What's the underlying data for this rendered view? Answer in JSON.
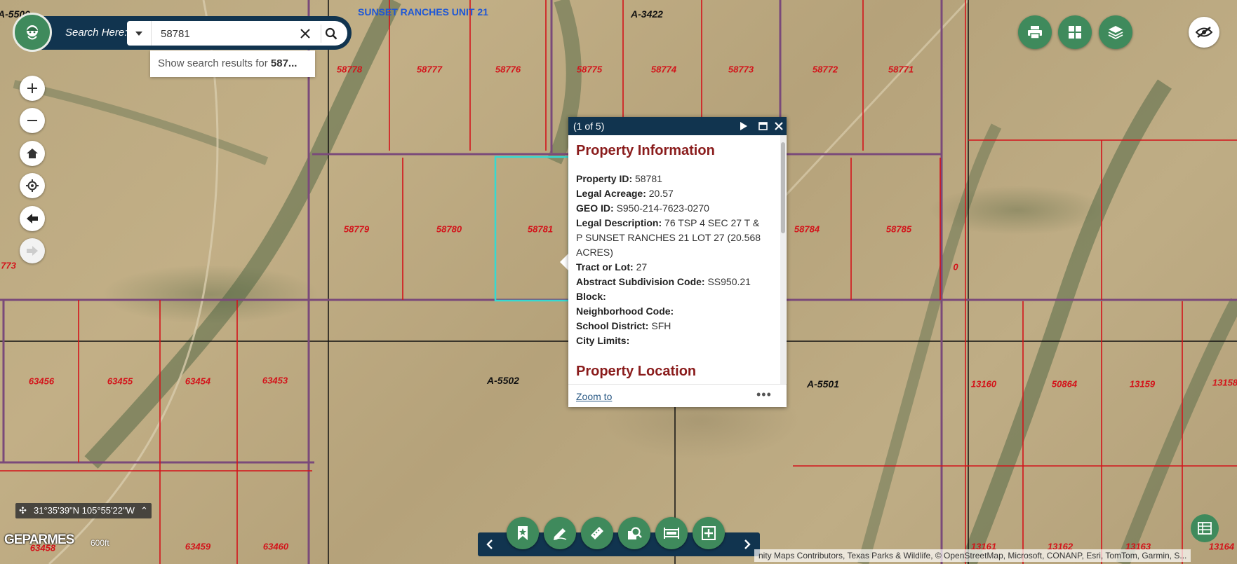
{
  "search": {
    "label": "Search Here:",
    "value": "58781",
    "suggestion_prefix": "Show search results for ",
    "suggestion_term": "587..."
  },
  "map": {
    "subdivision_label": "SUNSET RANCHES UNIT 21",
    "abstract_labels": [
      "A-5500",
      "A-3422",
      "A-5502",
      "A-5501"
    ],
    "parcel_labels": [
      "58778",
      "58777",
      "58776",
      "58775",
      "58774",
      "58773",
      "58772",
      "58771",
      "58779",
      "58780",
      "58781",
      "58784",
      "58785",
      "63456",
      "63455",
      "63454",
      "63453",
      "13160",
      "50864",
      "13159",
      "13158",
      "63458",
      "63459",
      "63460",
      "13161",
      "13162",
      "13163",
      "13164",
      "773",
      "0"
    ]
  },
  "popup": {
    "count": "(1 of 5)",
    "section_info": "Property Information",
    "fields": [
      {
        "label": "Property ID:",
        "value": "58781"
      },
      {
        "label": "Legal Acreage:",
        "value": "20.57"
      },
      {
        "label": "GEO ID:",
        "value": "S950-214-7623-0270"
      },
      {
        "label": "Legal Description:",
        "value": "76 TSP 4 SEC 27 T & P SUNSET RANCHES 21 LOT 27 (20.568 ACRES)"
      },
      {
        "label": "Tract or Lot:",
        "value": "27"
      },
      {
        "label": "Abstract Subdivision Code:",
        "value": "SS950.21"
      },
      {
        "label": "Block:",
        "value": ""
      },
      {
        "label": "Neighborhood Code:",
        "value": ""
      },
      {
        "label": "School District:",
        "value": "SFH"
      },
      {
        "label": "City Limits:",
        "value": ""
      }
    ],
    "section_location": "Property Location",
    "zoom_link": "Zoom to",
    "more": "•••"
  },
  "coords": {
    "text": "31°35'39\"N 105°55'22\"W"
  },
  "attribution": "nity Maps Contributors, Texas Parks & Wildlife, © OpenStreetMap, Microsoft, CONANP, Esri, TomTom, Garmin, S...",
  "brand": "GEPARMES",
  "scale_label": "600ft",
  "colors": {
    "navy": "#11344f",
    "green": "#3f8a5c",
    "parcel_red": "#d3131a",
    "title_red": "#8a1c1c",
    "link_blue": "#2c5b86"
  },
  "icons": {
    "left_controls": [
      "plus-icon",
      "minus-icon",
      "home-icon",
      "locate-icon",
      "back-arrow-icon",
      "forward-arrow-icon"
    ],
    "top_right": [
      "print-icon",
      "grid-icon",
      "layers-icon",
      "hide-icon"
    ],
    "toolbar": [
      "bookmark-icon",
      "draw-icon",
      "measure-icon",
      "identify-icon",
      "select-icon",
      "add-icon"
    ]
  }
}
